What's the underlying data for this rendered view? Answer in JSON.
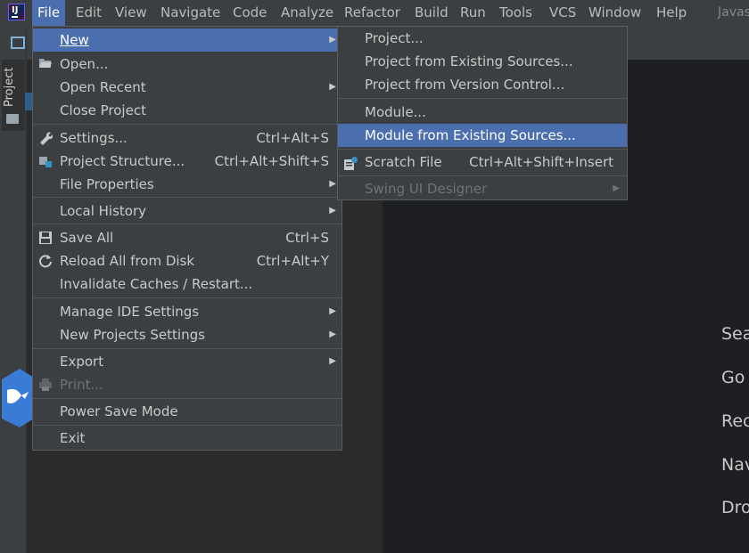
{
  "menubar": {
    "items": [
      "File",
      "Edit",
      "View",
      "Navigate",
      "Code",
      "Analyze",
      "Refactor",
      "Build",
      "Run",
      "Tools",
      "VCS",
      "Window",
      "Help"
    ],
    "title_fragment": "Javas"
  },
  "left_panel": {
    "project_tab": "Project"
  },
  "right_panel": {
    "fragments": [
      "Sea",
      "Go",
      "Rec",
      "Nav",
      "Dro"
    ]
  },
  "file_menu": {
    "new": "New",
    "open": "Open...",
    "open_recent": "Open Recent",
    "close_project": "Close Project",
    "settings": "Settings...",
    "settings_sc": "Ctrl+Alt+S",
    "project_structure": "Project Structure...",
    "project_structure_sc": "Ctrl+Alt+Shift+S",
    "file_properties": "File Properties",
    "local_history": "Local History",
    "save_all": "Save All",
    "save_all_sc": "Ctrl+S",
    "reload": "Reload All from Disk",
    "reload_sc": "Ctrl+Alt+Y",
    "invalidate": "Invalidate Caches / Restart...",
    "manage_ide": "Manage IDE Settings",
    "new_projects": "New Projects Settings",
    "export": "Export",
    "print": "Print...",
    "power_save": "Power Save Mode",
    "exit": "Exit"
  },
  "new_submenu": {
    "project": "Project...",
    "project_existing": "Project from Existing Sources...",
    "project_vcs": "Project from Version Control...",
    "module": "Module...",
    "module_existing": "Module from Existing Sources...",
    "scratch": "Scratch File",
    "scratch_sc": "Ctrl+Alt+Shift+Insert",
    "swing": "Swing UI Designer"
  },
  "colors": {
    "highlight": "#4b6eaf",
    "menu_bg": "#3c3f41",
    "editor_bg": "#1e1f22"
  }
}
